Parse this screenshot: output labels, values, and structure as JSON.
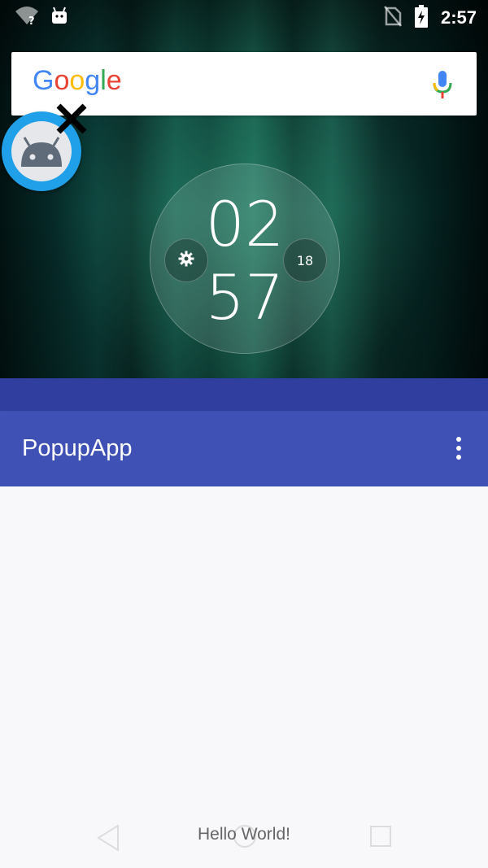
{
  "statusbar": {
    "time": "2:57",
    "icons": [
      "wifi-unknown-icon",
      "android-notification-icon",
      "no-sim-icon",
      "battery-charging-icon"
    ]
  },
  "search": {
    "brand": "Google",
    "colors": {
      "blue": "#4285f4",
      "red": "#ea4335",
      "yellow": "#fbbc05",
      "green": "#34a853"
    }
  },
  "clock": {
    "hours": "02",
    "minutes": "57",
    "date": "18"
  },
  "app": {
    "title": "PopupApp",
    "toolbar_color": "#3f51b5",
    "status_color": "#303f9f",
    "content_text": "Hello World!"
  },
  "navbar": [
    "back-icon",
    "home-icon",
    "recents-icon"
  ]
}
